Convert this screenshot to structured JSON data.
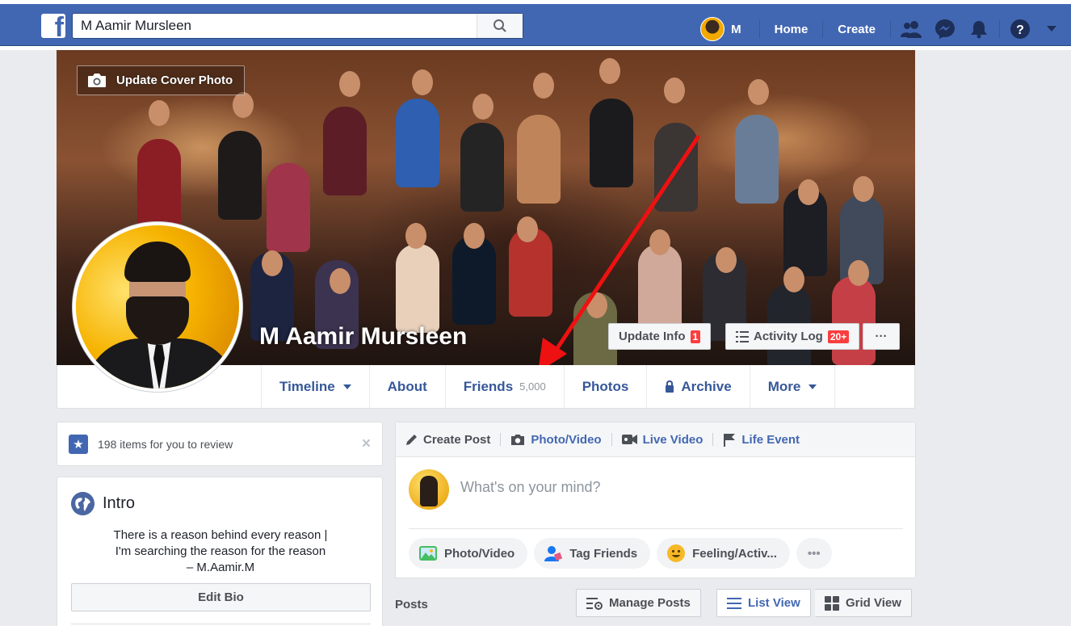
{
  "header": {
    "search_value": "M Aamir Mursleen",
    "user_short": "M",
    "nav": {
      "home": "Home",
      "create": "Create"
    }
  },
  "cover": {
    "update_cover": "Update Cover Photo",
    "name": "M Aamir Mursleen",
    "update_info": "Update Info",
    "update_info_badge": "1",
    "activity_log": "Activity Log",
    "activity_log_badge": "20+",
    "more_dots": "···"
  },
  "profile_nav": {
    "timeline": "Timeline",
    "about": "About",
    "friends": "Friends",
    "friends_count": "5,000",
    "photos": "Photos",
    "archive": "Archive",
    "more": "More"
  },
  "review": {
    "text": "198 items for you to review",
    "close": "×"
  },
  "intro": {
    "title": "Intro",
    "bio_lines": [
      "There is a reason behind every reason |",
      "I'm searching the reason for the reason",
      "– M.Aamir.M"
    ],
    "edit_bio": "Edit Bio"
  },
  "composer": {
    "tabs": {
      "create_post": "Create Post",
      "photo_video": "Photo/Video",
      "live_video": "Live Video",
      "life_event": "Life Event"
    },
    "placeholder": "What's on your mind?",
    "pills": {
      "photo_video": "Photo/Video",
      "tag_friends": "Tag Friends",
      "feeling": "Feeling/Activ...",
      "more": "•••"
    }
  },
  "posts": {
    "label": "Posts",
    "manage_posts": "Manage Posts",
    "list_view": "List View",
    "grid_view": "Grid View"
  },
  "colors": {
    "brand": "#4267b2",
    "link": "#365899",
    "badge": "#fa3e3e",
    "arrow": "#ee1111"
  }
}
